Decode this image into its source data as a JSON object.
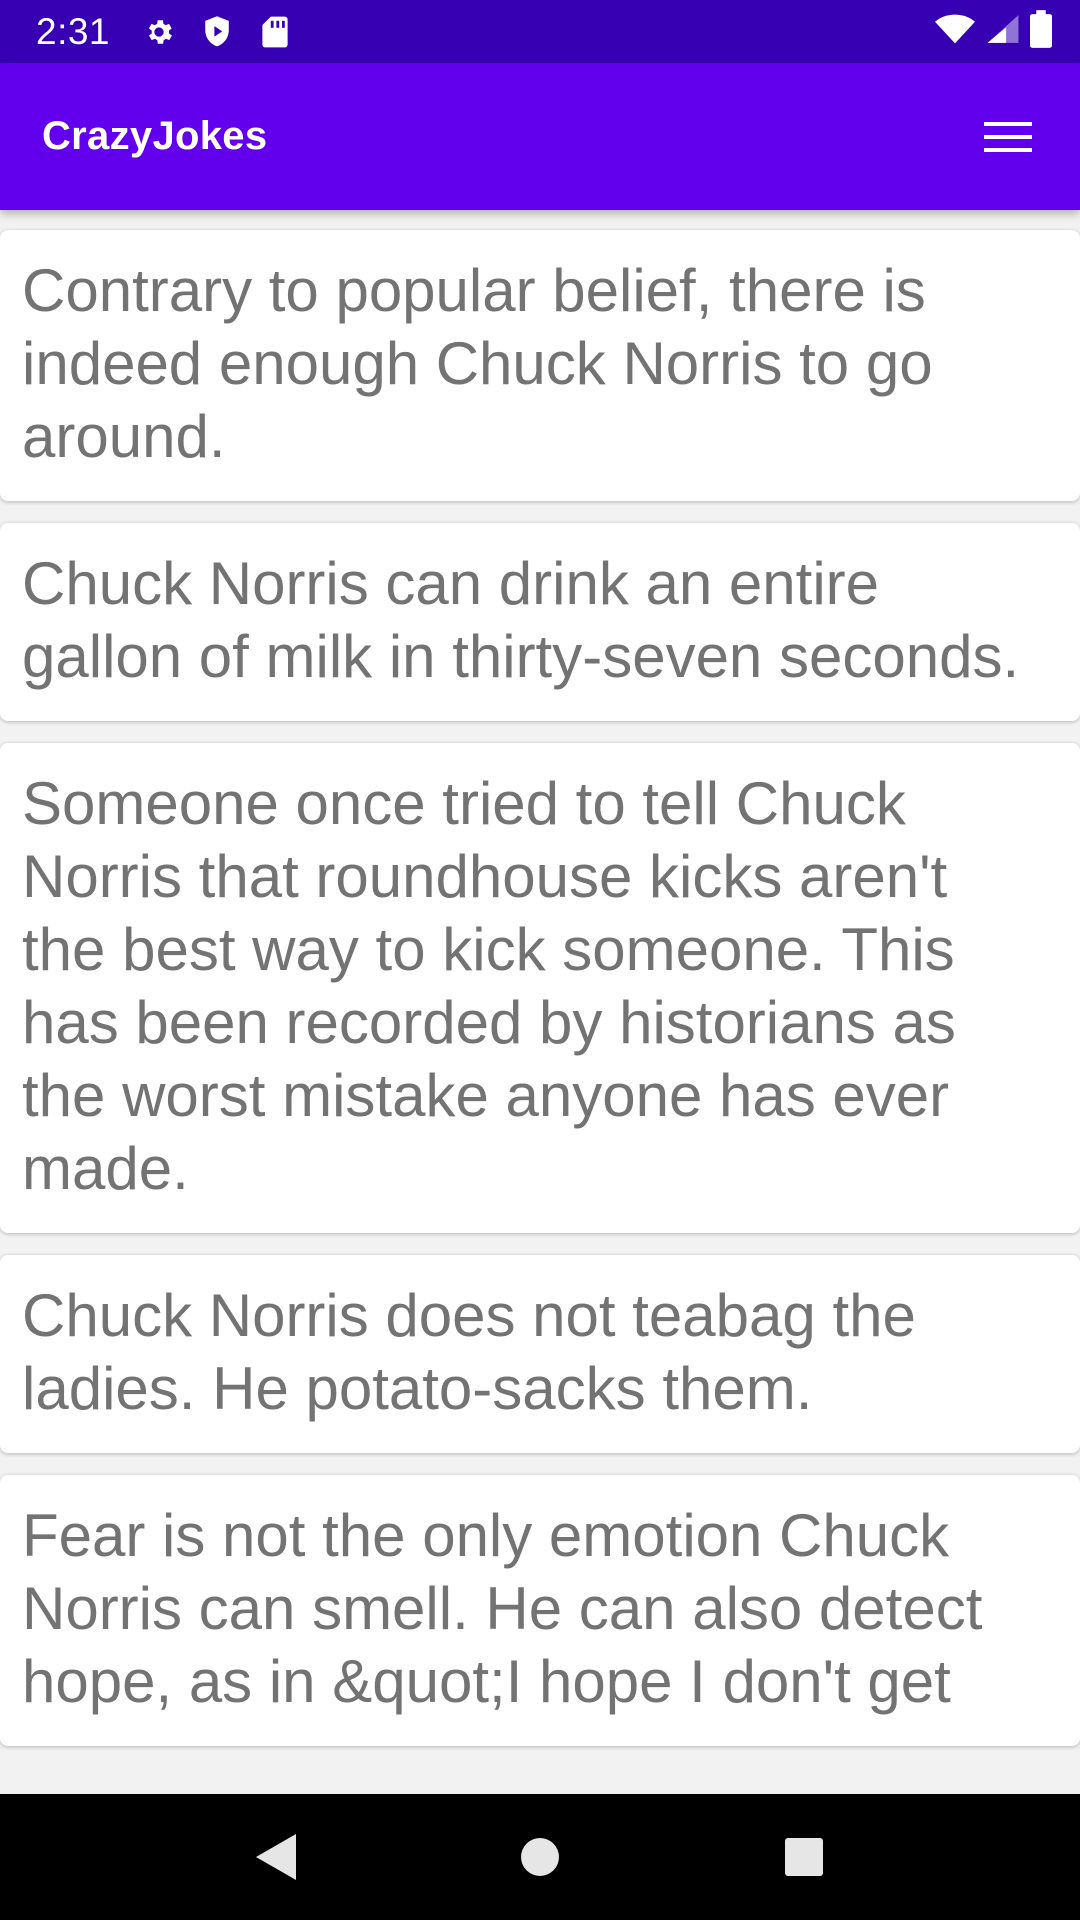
{
  "status_bar": {
    "time": "2:31",
    "left_icons": [
      "gear-icon",
      "shield-play-icon",
      "sd-card-icon"
    ],
    "right_icons": [
      "wifi-icon",
      "signal-icon",
      "battery-icon"
    ]
  },
  "app_bar": {
    "title": "CrazyJokes",
    "menu_icon": "hamburger-menu-icon",
    "background": "#6200ee"
  },
  "jokes": [
    "Contrary to popular belief, there is indeed enough Chuck Norris to go around.",
    "Chuck Norris can drink an entire gallon of milk in thirty-seven seconds.",
    "Someone once tried to tell Chuck Norris that roundhouse kicks aren't the best way to kick someone. This has been recorded by historians as the worst mistake anyone has ever made.",
    "Chuck Norris does not teabag the ladies. He potato-sacks them.",
    "Fear is not the only emotion Chuck Norris can smell. He can also detect hope, as in &quot;I hope I don't get"
  ],
  "nav_bar": {
    "buttons": [
      "back-icon",
      "home-icon",
      "recents-icon"
    ]
  },
  "colors": {
    "status_bar": "#3700b3",
    "app_bar": "#6200ee",
    "joke_text": "#737373",
    "list_background": "#f2f2f2"
  }
}
